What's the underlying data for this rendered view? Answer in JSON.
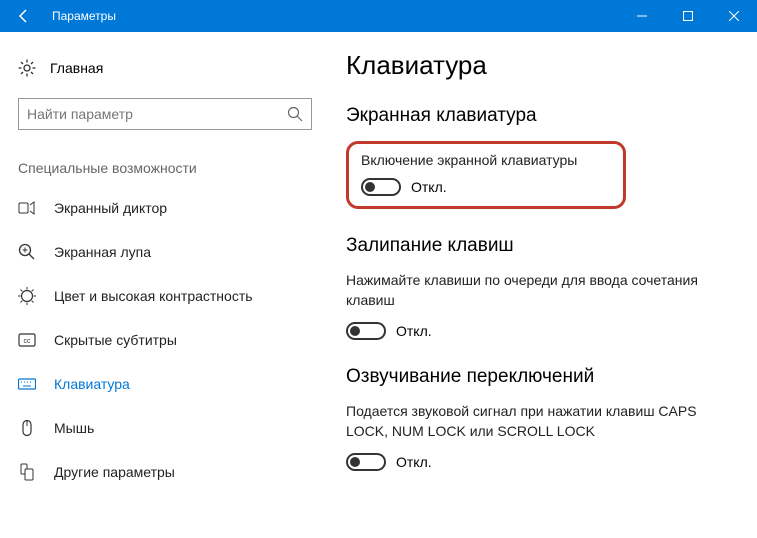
{
  "titlebar": {
    "title": "Параметры"
  },
  "sidebar": {
    "home": "Главная",
    "search_placeholder": "Найти параметр",
    "group_label": "Специальные возможности",
    "items": [
      {
        "label": "Экранный диктор"
      },
      {
        "label": "Экранная лупа"
      },
      {
        "label": "Цвет и высокая контрастность"
      },
      {
        "label": "Скрытые субтитры"
      },
      {
        "label": "Клавиатура"
      },
      {
        "label": "Мышь"
      },
      {
        "label": "Другие параметры"
      }
    ]
  },
  "main": {
    "title": "Клавиатура",
    "section1": {
      "heading": "Экранная клавиатура",
      "option_label": "Включение экранной клавиатуры",
      "toggle_state": "Откл."
    },
    "section2": {
      "heading": "Залипание клавиш",
      "desc": "Нажимайте клавиши по очереди для ввода сочетания клавиш",
      "toggle_state": "Откл."
    },
    "section3": {
      "heading": "Озвучивание переключений",
      "desc": "Подается звуковой сигнал при нажатии клавиш CAPS LOCK, NUM LOCK или SCROLL LOCK",
      "toggle_state": "Откл."
    }
  }
}
